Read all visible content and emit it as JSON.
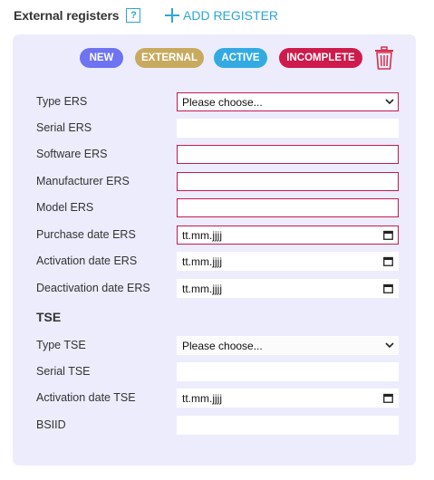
{
  "header": {
    "title": "External registers",
    "help": "?",
    "add_label": "ADD REGISTER"
  },
  "badges": [
    {
      "label": "NEW",
      "color": "#6e73f2"
    },
    {
      "label": "EXTERNAL",
      "color": "#c8aa5f"
    },
    {
      "label": "ACTIVE",
      "color": "#33abe2"
    },
    {
      "label": "INCOMPLETE",
      "color": "#ce1b4b"
    }
  ],
  "colors": {
    "accent": "#2ba6d6",
    "error_border": "#c51950",
    "card_bg": "#ececfd",
    "trash": "#d6304d"
  },
  "ers": {
    "type_label": "Type ERS",
    "type_value": "Please choose...",
    "serial_label": "Serial ERS",
    "serial_value": "",
    "software_label": "Software ERS",
    "software_value": "",
    "manufacturer_label": "Manufacturer ERS",
    "manufacturer_value": "",
    "model_label": "Model ERS",
    "model_value": "",
    "purchase_label": "Purchase date ERS",
    "purchase_value": "tt.mm.jjjj",
    "activation_label": "Activation date ERS",
    "activation_value": "tt.mm.jjjj",
    "deactivation_label": "Deactivation date ERS",
    "deactivation_value": "tt.mm.jjjj"
  },
  "tse": {
    "heading": "TSE",
    "type_label": "Type TSE",
    "type_value": "Please choose...",
    "serial_label": "Serial TSE",
    "serial_value": "",
    "activation_label": "Activation date TSE",
    "activation_value": "tt.mm.jjjj",
    "bsiid_label": "BSIID",
    "bsiid_value": ""
  },
  "icons": {
    "add": "plus-icon",
    "delete": "trash-icon",
    "select": "chevron-down-icon",
    "date": "calendar-icon"
  }
}
